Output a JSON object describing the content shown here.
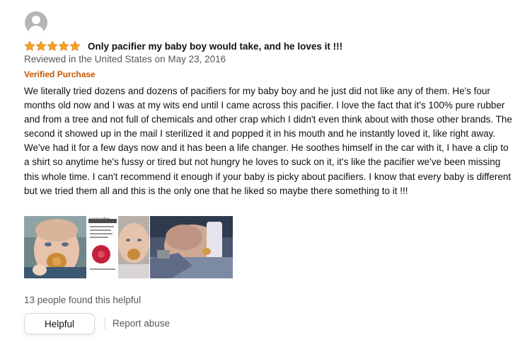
{
  "review": {
    "rating": 5,
    "rating_max": 5,
    "star_color": "#f4a41c",
    "title": "Only pacifier my baby boy would take, and he loves it !!!",
    "meta": "Reviewed in the United States on May 23, 2016",
    "badge": "Verified Purchase",
    "badge_color": "#c45500",
    "body": "We literally tried dozens and dozens of pacifiers for my baby boy and he just did not like any of them. He's four months old now and I was at my wits end until I came across this pacifier. I love the fact that it's 100% pure rubber and from a tree and not full of chemicals and other crap which I didn't even think about with those other brands. The second it showed up in the mail I sterilized it and popped it in his mouth and he instantly loved it, like right away. We've had it for a few days now and it has been a life changer. He soothes himself in the car with it, I have a clip to a shirt so anytime he's fussy or tired but not hungry he loves to suck on it, it's like the pacifier we've been missing this whole time. I can't recommend it enough if your baby is picky about pacifiers. I know that every baby is different but we tried them all and this is the only one that he liked so maybe there something to it !!!",
    "images": [
      {
        "name": "review-photo-baby-with-pacifier"
      },
      {
        "name": "review-photo-packaging-and-baby",
        "brand_text": "ecopacifier"
      },
      {
        "name": "review-photo-sleeping-baby"
      }
    ],
    "helpful_count": "13 people found this helpful",
    "helpful_button": "Helpful",
    "report_link": "Report abuse"
  }
}
